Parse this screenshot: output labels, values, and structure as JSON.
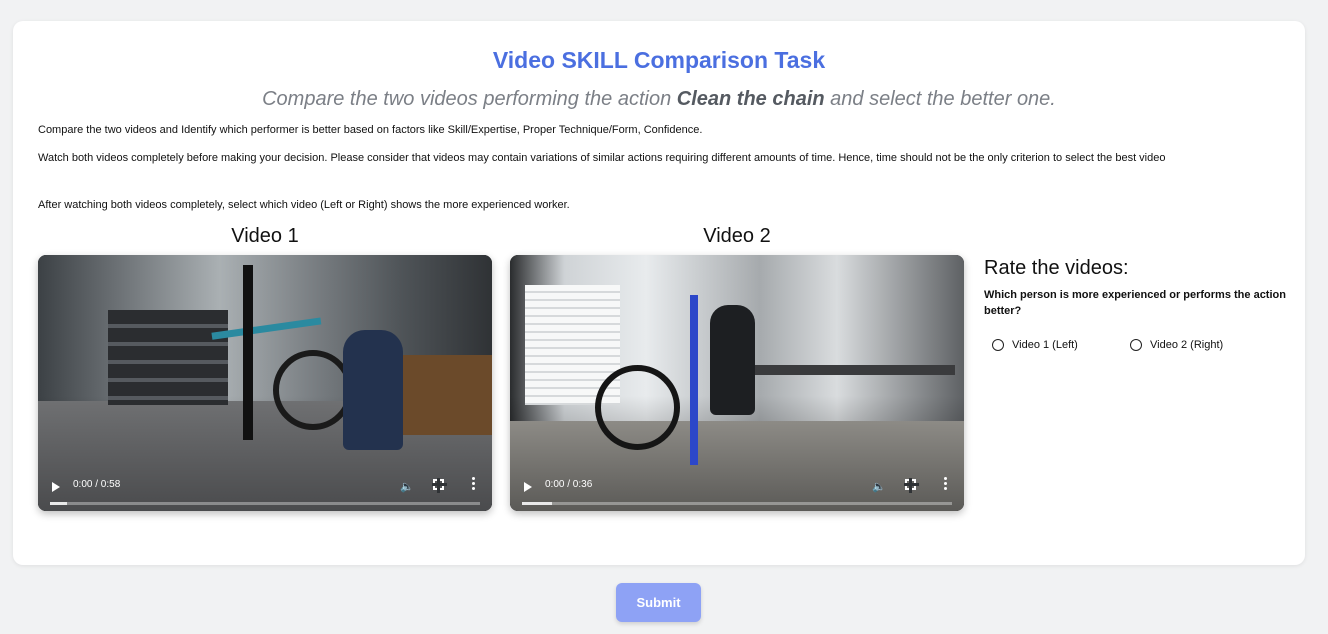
{
  "page": {
    "title": "Video SKILL Comparison Task",
    "subtitle_pre": "Compare the two videos performing the action ",
    "subtitle_action": "Clean the chain",
    "subtitle_post": " and select the better one.",
    "paragraph1": "Compare the two videos and Identify which performer is better based on factors like Skill/Expertise, Proper Technique/Form, Confidence.",
    "paragraph2": "Watch both videos completely before making your decision. Please consider that videos may contain variations of similar actions requiring different amounts of time. Hence, time should not be the only criterion to select the best video",
    "paragraph3": "After watching both videos completely, select which video (Left or Right) shows the more experienced worker."
  },
  "videos": [
    {
      "label": "Video 1",
      "time": "0:00 / 0:58",
      "progress": 0.04
    },
    {
      "label": "Video 2",
      "time": "0:00 / 0:36",
      "progress": 0.07
    }
  ],
  "rating": {
    "title": "Rate the videos:",
    "question": "Which person is more experienced or performs the action better?",
    "options": [
      "Video 1 (Left)",
      "Video 2 (Right)"
    ]
  },
  "submit_label": "Submit",
  "colors": {
    "title": "#4b6fe0",
    "submit": "#8ea2f5",
    "background": "#f1f2f3"
  }
}
